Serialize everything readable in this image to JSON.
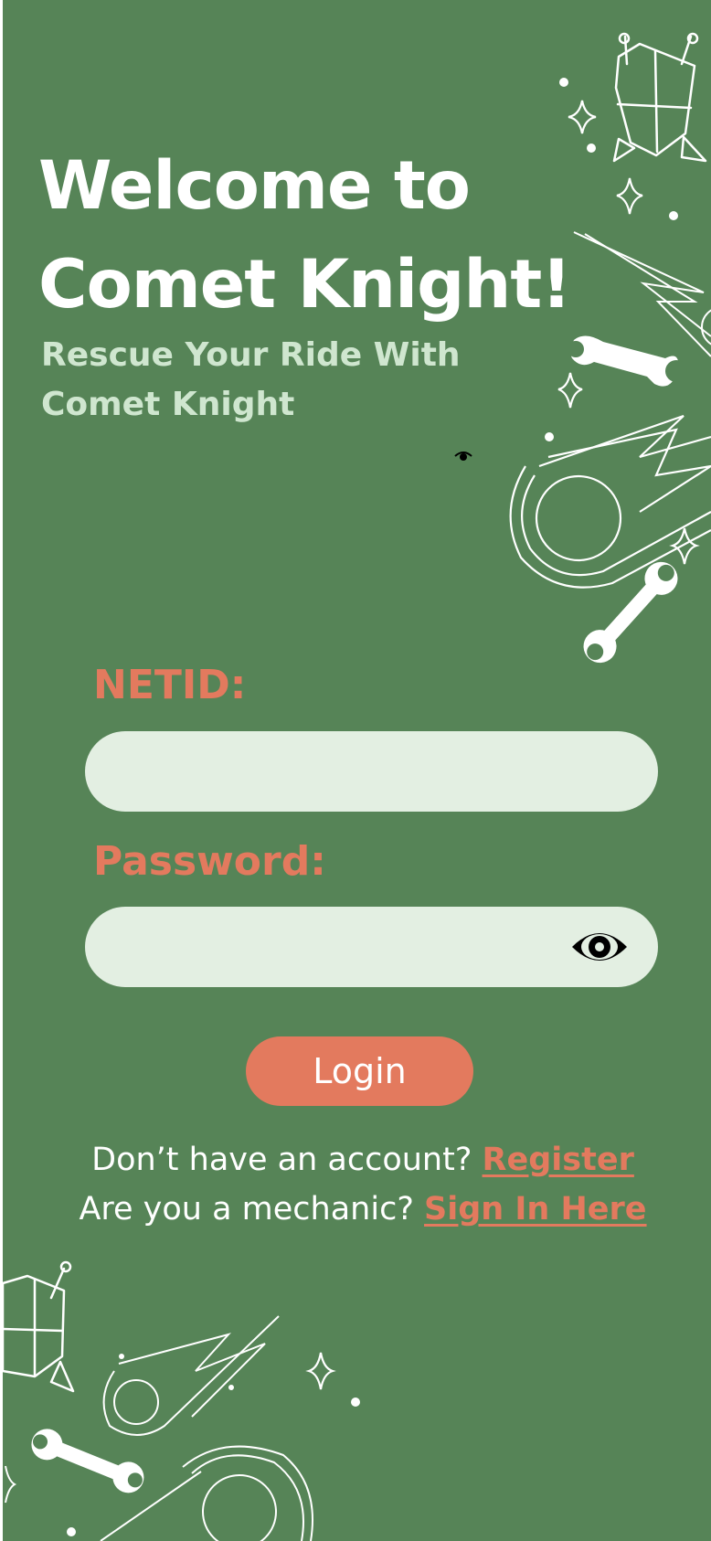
{
  "app": {
    "title_line_1": "Welcome to",
    "title_line_2": "Comet Knight!",
    "subtitle_line_1": "Rescue Your Ride With",
    "subtitle_line_2": "Comet Knight"
  },
  "form": {
    "netid_label": "NETID:",
    "netid_value": "",
    "netid_placeholder": "",
    "password_label": "Password:",
    "password_value": "",
    "password_placeholder": "",
    "password_toggle_icon": "eye-icon",
    "login_label": "Login"
  },
  "links": {
    "register_prompt": "Don’t have an account? ",
    "register_label": "Register",
    "mechanic_prompt": "Are you a mechanic? ",
    "mechanic_label": "Sign In Here"
  },
  "colors": {
    "background": "#568457",
    "accent": "#e37a5e",
    "field": "#e3efe2",
    "subtitle": "#cfe6cf",
    "text": "#ffffff"
  }
}
